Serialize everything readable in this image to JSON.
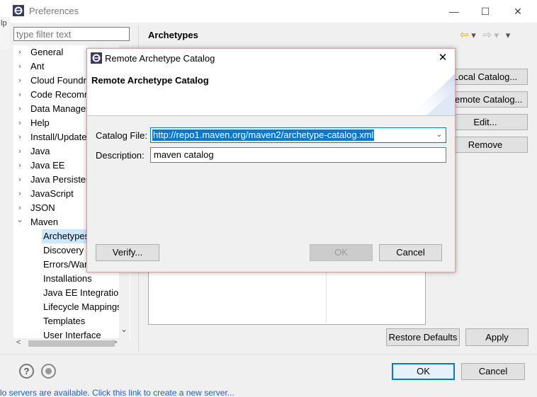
{
  "window": {
    "title": "Preferences",
    "minimize_glyph": "—",
    "maximize_glyph": "☐",
    "close_glyph": "✕",
    "left_strip_text": "lp"
  },
  "filter": {
    "placeholder": "type filter text"
  },
  "tree": {
    "items": [
      {
        "label": "General",
        "expandable": true
      },
      {
        "label": "Ant",
        "expandable": true
      },
      {
        "label": "Cloud Foundry",
        "expandable": true
      },
      {
        "label": "Code Recommenders",
        "expandable": true
      },
      {
        "label": "Data Management",
        "expandable": true
      },
      {
        "label": "Help",
        "expandable": true
      },
      {
        "label": "Install/Update",
        "expandable": true
      },
      {
        "label": "Java",
        "expandable": true
      },
      {
        "label": "Java EE",
        "expandable": true
      },
      {
        "label": "Java Persistence",
        "expandable": true
      },
      {
        "label": "JavaScript",
        "expandable": true
      },
      {
        "label": "JSON",
        "expandable": true
      },
      {
        "label": "Maven",
        "expandable": true,
        "expanded": true
      }
    ],
    "children": [
      {
        "label": "Archetypes",
        "selected": true
      },
      {
        "label": "Discovery"
      },
      {
        "label": "Errors/Warnings"
      },
      {
        "label": "Installations"
      },
      {
        "label": "Java EE Integration"
      },
      {
        "label": "Lifecycle Mappings"
      },
      {
        "label": "Templates"
      },
      {
        "label": "User Interface"
      }
    ],
    "collapsed_chevron": "›",
    "expanded_chevron": "⌄",
    "scroll_down_glyph": "⌄",
    "scroll_left_glyph": "<",
    "scroll_right_glyph": ">"
  },
  "pane": {
    "title": "Archetypes",
    "back_arrow": "⇦",
    "forward_arrow": "⇨",
    "menu_arrow": "▾",
    "buttons": {
      "add_local": "Local Catalog...",
      "add_remote": "Remote Catalog...",
      "edit": "Edit...",
      "remove": "Remove"
    },
    "restore_defaults": "Restore Defaults",
    "apply": "Apply"
  },
  "footer": {
    "ok": "OK",
    "cancel": "Cancel",
    "help_glyph": "?",
    "status_text": "lo servers are available. Click this link to create a new server..."
  },
  "dialog": {
    "title": "Remote Archetype Catalog",
    "banner_title": "Remote Archetype Catalog",
    "close_glyph": "✕",
    "catalog_label": "Catalog File:",
    "catalog_value": "http://repo1.maven.org/maven2/archetype-catalog.xml",
    "dropdown_glyph": "⌄",
    "description_label": "Description:",
    "description_value": "maven catalog",
    "verify": "Verify...",
    "ok": "OK",
    "cancel": "Cancel"
  },
  "colors": {
    "selection": "#0078d7",
    "tree_selection": "#cce8ff",
    "dialog_border": "#c9a7a7",
    "link": "#2060c0"
  }
}
